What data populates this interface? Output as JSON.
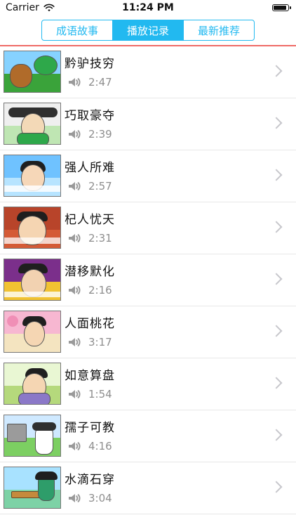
{
  "status": {
    "carrier": "Carrier",
    "time": "11:24 PM"
  },
  "tabs": [
    {
      "label": "成语故事",
      "active": false
    },
    {
      "label": "播放记录",
      "active": true
    },
    {
      "label": "最新推荐",
      "active": false
    }
  ],
  "colors": {
    "accent": "#22b9f0",
    "header_line": "#ef6a66",
    "secondary_text": "#8e8e8e",
    "chevron": "#c7c7cc"
  },
  "list": {
    "items": [
      {
        "title": "黔驴技穷",
        "duration": "2:47",
        "thumb_theme": "forest"
      },
      {
        "title": "巧取豪夺",
        "duration": "2:39",
        "thumb_theme": "official"
      },
      {
        "title": "强人所难",
        "duration": "2:57",
        "thumb_theme": "girl"
      },
      {
        "title": "杞人忧天",
        "duration": "2:31",
        "thumb_theme": "thinking"
      },
      {
        "title": "潜移默化",
        "duration": "2:16",
        "thumb_theme": "scholar"
      },
      {
        "title": "人面桃花",
        "duration": "3:17",
        "thumb_theme": "peach"
      },
      {
        "title": "如意算盘",
        "duration": "1:54",
        "thumb_theme": "laughing"
      },
      {
        "title": "孺子可教",
        "duration": "4:16",
        "thumb_theme": "village"
      },
      {
        "title": "水滴石穿",
        "duration": "3:04",
        "thumb_theme": "desk"
      }
    ]
  },
  "icons": {
    "speaker": "speaker-icon",
    "chevron": "chevron-right-icon",
    "wifi": "wifi-icon",
    "battery": "battery-icon"
  }
}
